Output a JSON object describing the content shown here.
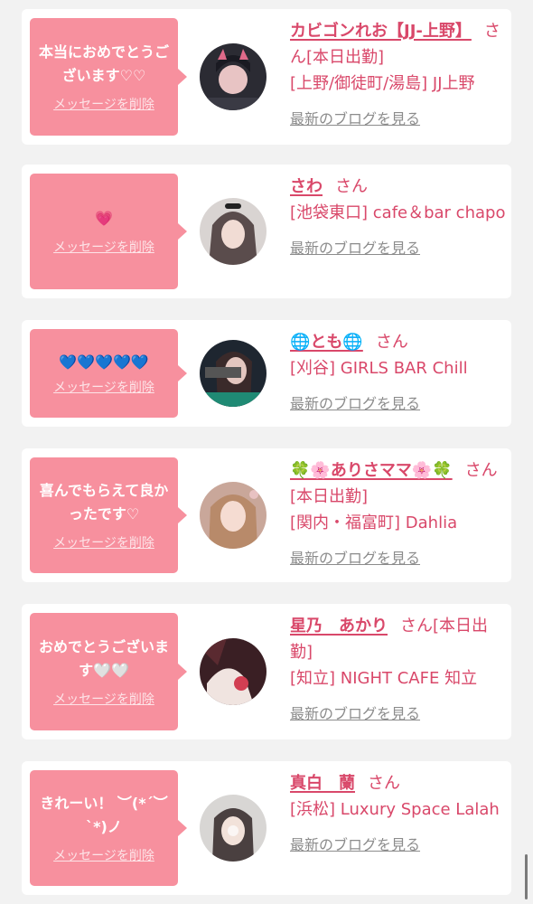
{
  "messages": [
    {
      "message": "本当におめでとうございます♡♡",
      "delete_label": "メッセージを削除",
      "name": "カビゴンれお【JJ-上野】",
      "honorific": "さん",
      "status": "[本日出勤]",
      "shop": "[上野/御徒町/湯島] JJ上野",
      "blog_label": "最新のブログを見る"
    },
    {
      "message": "💗",
      "delete_label": "メッセージを削除",
      "name": "さわ",
      "honorific": "さん",
      "status": "",
      "shop": "[池袋東口] cafe＆bar chapo",
      "blog_label": "最新のブログを見る"
    },
    {
      "message": "💙💙💙💙💙",
      "delete_label": "メッセージを削除",
      "name": "🌐とも🌐",
      "honorific": "さん",
      "status": "",
      "shop": "[刈谷] GIRLS BAR Chill",
      "blog_label": "最新のブログを見る"
    },
    {
      "message": "喜んでもらえて良かったです♡",
      "delete_label": "メッセージを削除",
      "name": "🍀🌸ありさママ🌸🍀",
      "honorific": "さん",
      "status": "[本日出勤]",
      "shop": "[関内・福富町] Dahlia",
      "blog_label": "最新のブログを見る"
    },
    {
      "message": "おめでとうございます🤍🤍",
      "delete_label": "メッセージを削除",
      "name": "星乃　あかり",
      "honorific": "さん",
      "status": "[本日出勤]",
      "shop": "[知立] NIGHT CAFE 知立",
      "blog_label": "最新のブログを見る"
    },
    {
      "message": "きれーい！ ︶(*´︶`*)ノ",
      "delete_label": "メッセージを削除",
      "name": "真白　蘭",
      "honorific": "さん",
      "status": "",
      "shop": "[浜松] Luxury Space Lalah",
      "blog_label": "最新のブログを見る"
    }
  ],
  "colors": {
    "accent": "#d9486a",
    "bubble": "#f7909e",
    "muted": "#8c8c8c",
    "background": "#f2f2f2"
  }
}
